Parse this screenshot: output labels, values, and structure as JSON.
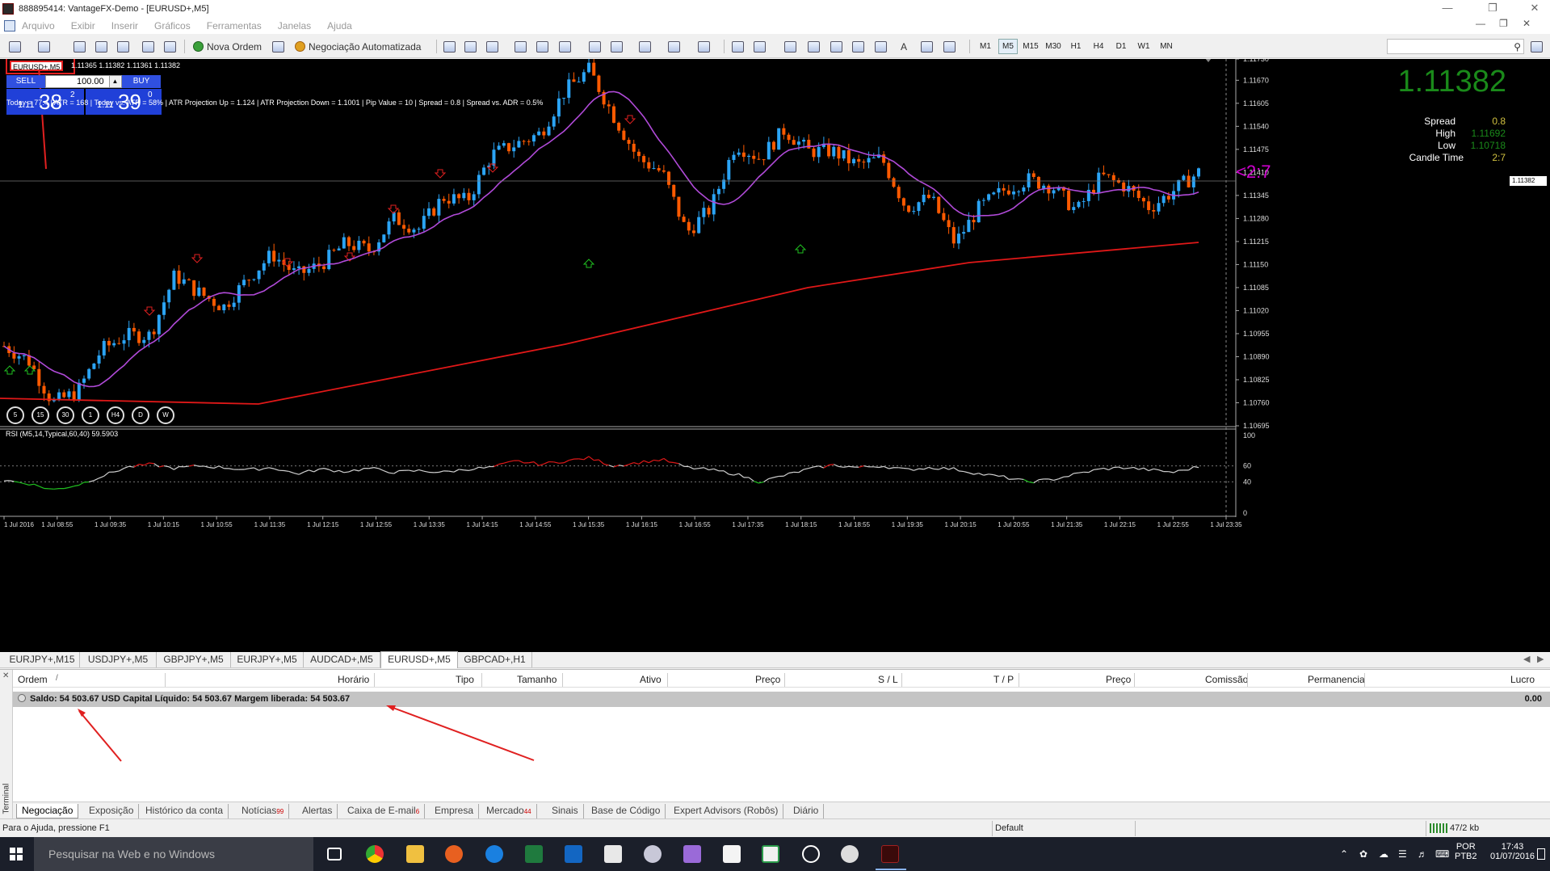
{
  "window": {
    "title": "888895414: VantageFX-Demo - [EURUSD+,M5]"
  },
  "menu": [
    "Arquivo",
    "Exibir",
    "Inserir",
    "Gráficos",
    "Ferramentas",
    "Janelas",
    "Ajuda"
  ],
  "toolbar": {
    "new_order": "Nova Ordem",
    "auto_trading": "Negociação Automatizada",
    "text_tool": "A",
    "timeframes": [
      "M1",
      "M5",
      "M15",
      "M30",
      "H1",
      "H4",
      "D1",
      "W1",
      "MN"
    ],
    "active_timeframe": "M5"
  },
  "chart": {
    "symbol_header": "EURUSD+,M5",
    "ohlc": "1.11365 1.11382 1.11361 1.11382",
    "one_click": {
      "sell": "SELL",
      "buy": "BUY",
      "lot": "100.00",
      "sell_price_small": "1.11",
      "sell_price_big": "38",
      "sell_price_sup": "2",
      "buy_price_small": "1.11",
      "buy_price_big": "39",
      "buy_price_sup": "0"
    },
    "info_line": [
      "Today = 77.4",
      "ATR = 168",
      "Today vs. ATR = 58%",
      "ATR Projection Up = 1.124",
      "ATR Projection Down = 1.1001",
      "Pip Value = 10",
      "Spread = 0.8",
      "Spread vs. ADR = 0.5%"
    ],
    "big_price": "1.11382",
    "info_panel": [
      {
        "label": "Spread",
        "value": "0.8"
      },
      {
        "label": "High",
        "value": "1.11692"
      },
      {
        "label": "Low",
        "value": "1.10718"
      },
      {
        "label": "Candle Time",
        "value": "2:7"
      }
    ],
    "countdown": "<2:7",
    "current_price_label": "1.11382",
    "timeframe_buttons": [
      "5",
      "15",
      "30",
      "1",
      "H4",
      "D",
      "W"
    ],
    "rsi_label": "RSI (M5,14,Typical,60,40) 59.5903",
    "colors": {
      "bull": "#2ba4f5",
      "bear": "#ff5a00",
      "ma_fast": "#b04ad8",
      "ma_slow": "#e01818",
      "rsi_up": "#e01818",
      "rsi_down": "#20c020",
      "rsi_mid": "#d0d0d0",
      "accent_price": "#1a8a1a",
      "countdown": "#d000d0"
    }
  },
  "chart_data": {
    "type": "candlestick",
    "ylim": [
      1.10695,
      1.1173
    ],
    "price_ticks": [
      "1.11730",
      "1.11670",
      "1.11605",
      "1.11540",
      "1.11475",
      "1.11410",
      "1.11345",
      "1.11280",
      "1.11215",
      "1.11150",
      "1.11085",
      "1.11020",
      "1.10955",
      "1.10890",
      "1.10825",
      "1.10760",
      "1.10695"
    ],
    "time_labels": [
      "1 Jul 2016",
      "1 Jul 08:55",
      "1 Jul 09:35",
      "1 Jul 10:15",
      "1 Jul 10:55",
      "1 Jul 11:35",
      "1 Jul 12:15",
      "1 Jul 12:55",
      "1 Jul 13:35",
      "1 Jul 14:15",
      "1 Jul 14:55",
      "1 Jul 15:35",
      "1 Jul 16:15",
      "1 Jul 16:55",
      "1 Jul 17:35",
      "1 Jul 18:15",
      "1 Jul 18:55",
      "1 Jul 19:35",
      "1 Jul 20:15",
      "1 Jul 20:55",
      "1 Jul 21:35",
      "1 Jul 22:15",
      "1 Jul 22:55",
      "1 Jul 23:35"
    ],
    "close_path": [
      1.1092,
      1.1088,
      1.1076,
      1.1079,
      1.1091,
      1.1095,
      1.1095,
      1.1112,
      1.1107,
      1.1103,
      1.1111,
      1.1118,
      1.1112,
      1.1115,
      1.1121,
      1.1119,
      1.1128,
      1.1125,
      1.1134,
      1.1133,
      1.1146,
      1.1149,
      1.1152,
      1.1164,
      1.117,
      1.1157,
      1.1145,
      1.1141,
      1.1124,
      1.1131,
      1.1149,
      1.1145,
      1.1153,
      1.1147,
      1.1147,
      1.1143,
      1.1145,
      1.1131,
      1.1134,
      1.1121,
      1.1131,
      1.1136,
      1.1139,
      1.1137,
      1.113,
      1.114,
      1.1137,
      1.1131,
      1.1136,
      1.1141
    ],
    "rsi_ylim": [
      0,
      100
    ],
    "rsi_levels": [
      60,
      40
    ],
    "rsi_ticks": [
      "100",
      "60",
      "40",
      "0"
    ],
    "rsi_path": [
      42,
      38,
      30,
      36,
      47,
      58,
      62,
      57,
      60,
      58,
      55,
      58,
      50,
      56,
      53,
      57,
      52,
      54,
      52,
      56,
      58,
      66,
      62,
      66,
      70,
      60,
      64,
      68,
      58,
      55,
      50,
      40,
      48,
      56,
      61,
      58,
      60,
      55,
      58,
      56,
      50,
      46,
      40,
      43,
      50,
      56,
      58,
      55,
      52,
      59
    ]
  },
  "chart_tabs": [
    "EURJPY+,M15",
    "USDJPY+,M5",
    "GBPJPY+,M5",
    "EURJPY+,M5",
    "AUDCAD+,M5",
    "EURUSD+,M5",
    "GBPCAD+,H1"
  ],
  "active_chart_tab": "EURUSD+,M5",
  "terminal": {
    "side_label": "Terminal",
    "columns": [
      "Ordem",
      "/",
      "Horário",
      "Tipo",
      "Tamanho",
      "Ativo",
      "Preço",
      "S / L",
      "T / P",
      "Preço",
      "Comissão",
      "Permanencia",
      "Lucro"
    ],
    "balance_text": "Saldo: 54 503.67 USD  Capital Líquido: 54 503.67  Margem liberada: 54 503.67",
    "profit": "0.00",
    "tabs": [
      {
        "label": "Negociação",
        "badge": ""
      },
      {
        "label": "Exposição",
        "badge": ""
      },
      {
        "label": "Histórico da conta",
        "badge": ""
      },
      {
        "label": "Notícias",
        "badge": "99"
      },
      {
        "label": "Alertas",
        "badge": ""
      },
      {
        "label": "Caixa de E-mail",
        "badge": "6"
      },
      {
        "label": "Empresa",
        "badge": ""
      },
      {
        "label": "Mercado",
        "badge": "44"
      },
      {
        "label": "Sinais",
        "badge": ""
      },
      {
        "label": "Base de Código",
        "badge": ""
      },
      {
        "label": "Expert Advisors (Robôs)",
        "badge": ""
      },
      {
        "label": "Diário",
        "badge": ""
      }
    ]
  },
  "status": {
    "help": "Para o Ajuda, pressione F1",
    "profile": "Default",
    "traffic": "47/2 kb"
  },
  "taskbar": {
    "search_placeholder": "Pesquisar na Web e no Windows",
    "lang_top": "POR",
    "lang_bottom": "PTB2",
    "time": "17:43",
    "date": "01/07/2016"
  }
}
